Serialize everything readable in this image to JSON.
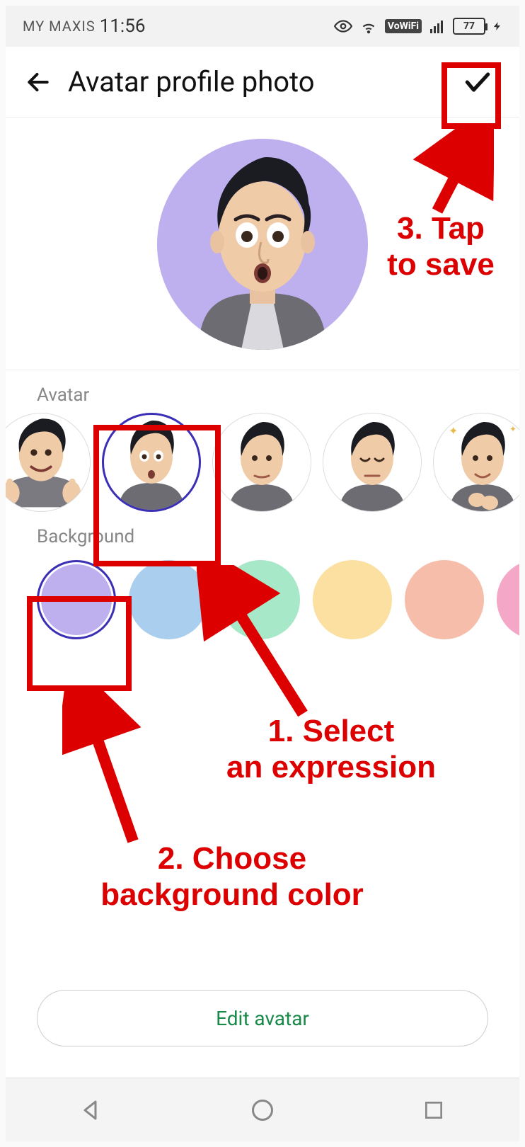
{
  "status": {
    "carrier": "MY MAXIS",
    "time": "11:56",
    "vowifi_label": "VoWiFi",
    "battery_pct": "77"
  },
  "app_bar": {
    "title": "Avatar profile photo"
  },
  "sections": {
    "avatar_label": "Avatar",
    "background_label": "Background"
  },
  "preview": {
    "background_color": "#beb0ee"
  },
  "avatar_options": {
    "selected_index": 1,
    "count": 5
  },
  "background_options": {
    "selected_index": 0,
    "colors": [
      "#beb0ee",
      "#a9ceee",
      "#a6e8c8",
      "#fbe0a1",
      "#f6bdaa",
      "#f4a7c6"
    ]
  },
  "edit_button_label": "Edit avatar",
  "annotations": {
    "step1": "1. Select\nan expression",
    "step2": "2. Choose\nbackground color",
    "step3": "3. Tap\nto save"
  }
}
